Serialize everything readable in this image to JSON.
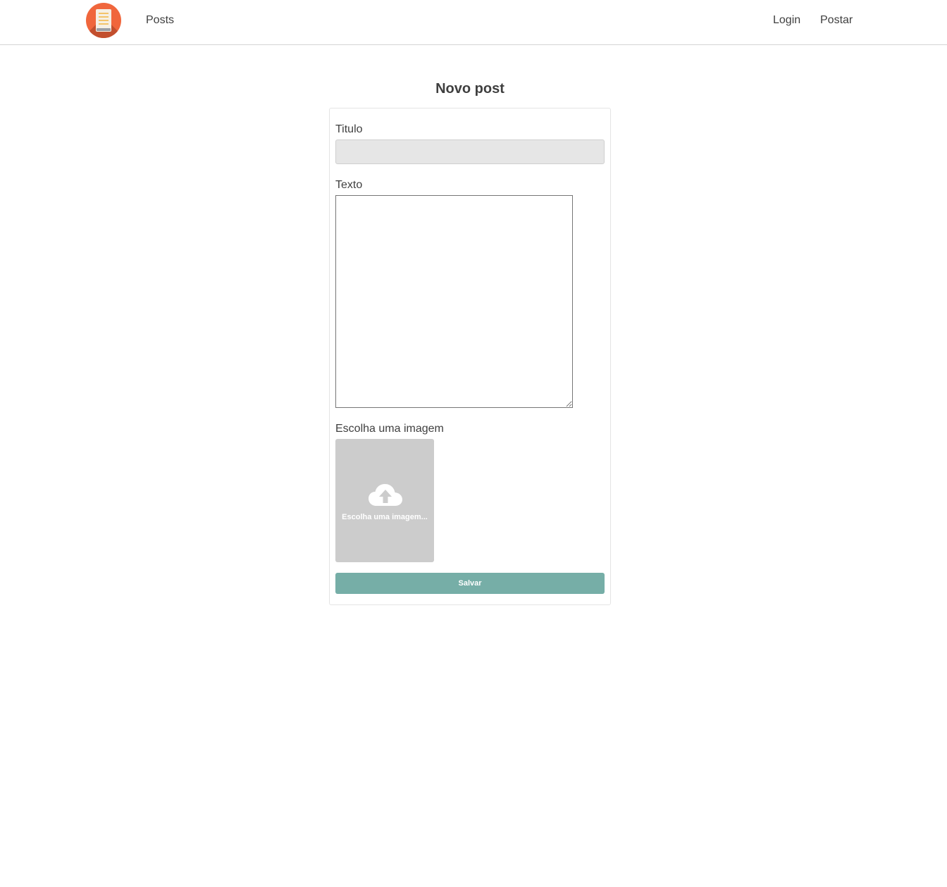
{
  "nav": {
    "logo_icon": "scroll-logo-icon",
    "posts_label": "Posts",
    "login_label": "Login",
    "postar_label": "Postar"
  },
  "page": {
    "title": "Novo post"
  },
  "form": {
    "titulo_label": "Titulo",
    "titulo_value": "",
    "texto_label": "Texto",
    "texto_value": "",
    "imagem_label": "Escolha uma imagem",
    "upload_icon": "cloud-upload-icon",
    "upload_text": "Escolha uma imagem...",
    "save_label": "Salvar"
  },
  "colors": {
    "logo": "#f0663c",
    "button": "#76aea7",
    "upload_box": "#cccccc",
    "input_bg": "#e6e6e6"
  }
}
